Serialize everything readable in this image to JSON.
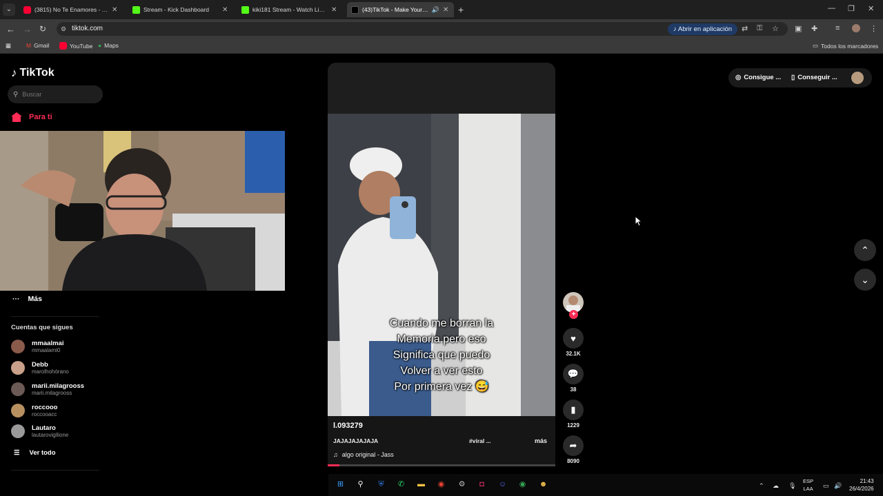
{
  "browser": {
    "tabs": [
      {
        "title": "(3815) No Te Enamores - YouTube",
        "icon": "youtube-icon"
      },
      {
        "title": "Stream - Kick Dashboard",
        "icon": "kick-icon"
      },
      {
        "title": "kiki181 Stream - Watch Live on Kick",
        "icon": "kick-icon"
      },
      {
        "title": "(43)TikTok - Make Your Day",
        "icon": "tiktok-icon",
        "active": true
      }
    ],
    "url": "tiktok.com",
    "open_app_label": "Abrir en aplicación",
    "bookmarks": [
      "Gmail",
      "YouTube",
      "Maps"
    ],
    "all_bookmarks_label": "Todos los marcadores"
  },
  "tiktok": {
    "logo": "TikTok",
    "search_placeholder": "Buscar",
    "nav_for_you": "Para ti",
    "more_label": "Más",
    "following_title": "Cuentas que sigues",
    "following": [
      {
        "name": "mmaalmai",
        "handle": "mmaalami0",
        "color": "#8a5a4a"
      },
      {
        "name": "Debb",
        "handle": "marolhohórano",
        "color": "#c9a08a"
      },
      {
        "name": "marii.milagrooss",
        "handle": "marii.milagrooss",
        "color": "#6b5a55"
      },
      {
        "name": "roccooo",
        "handle": "roccooacc",
        "color": "#b89060"
      },
      {
        "name": "Lautaro",
        "handle": "lautarovigllione",
        "color": "#9a9a9a"
      }
    ],
    "see_all_label": "Ver todo",
    "get_app_label": "Consigue ...",
    "get_coins_label": "Conseguir ...",
    "accent_color": "#fe2c55"
  },
  "video": {
    "caption_overlay": "Cuando me borran la\nMemoria pero eso\nSignifica que puedo\nVolver a ver esto\nPor primera vez 😅",
    "author": "l.093279",
    "description": "JAJAJAJAJAJA",
    "hashtag": "#viral ...",
    "more_label": "más",
    "music": "algo original - Jass",
    "progress": 0.05,
    "likes": "32.1K",
    "comments": "38",
    "saves": "1229",
    "shares": "8090"
  },
  "taskbar": {
    "language": "ESP",
    "layout": "LAA",
    "time": "21:43",
    "date": "26/4/2026"
  }
}
